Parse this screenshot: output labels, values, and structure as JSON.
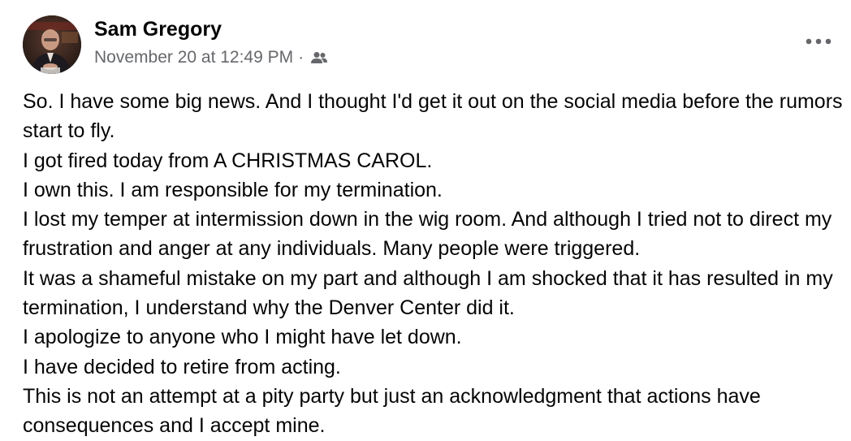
{
  "post": {
    "author": {
      "name": "Sam Gregory",
      "avatar_icon": "profile-photo"
    },
    "timestamp": "November 20 at 12:49 PM",
    "separator": "·",
    "audience_icon": "friends-icon",
    "more_icon": "more-options-icon",
    "colors": {
      "text": "#050505",
      "secondary_text": "#65676b",
      "background": "#ffffff"
    },
    "body_lines": [
      "So. I have some big news. And I thought I'd get it out on the social media before the rumors start to fly.",
      "I got fired today from A CHRISTMAS CAROL.",
      "I own this. I am responsible for my termination.",
      "I lost my temper at intermission down in the wig room. And although I tried not to direct my frustration and anger at any individuals. Many people were triggered.",
      "It was a shameful mistake on my part and although I am shocked that it has resulted in my termination, I understand why the Denver Center did it.",
      "I apologize to anyone who I might have let down.",
      "I have decided to retire from acting.",
      "This is not an attempt at a pity party but just an acknowledgment that actions have consequences and I accept mine."
    ]
  }
}
